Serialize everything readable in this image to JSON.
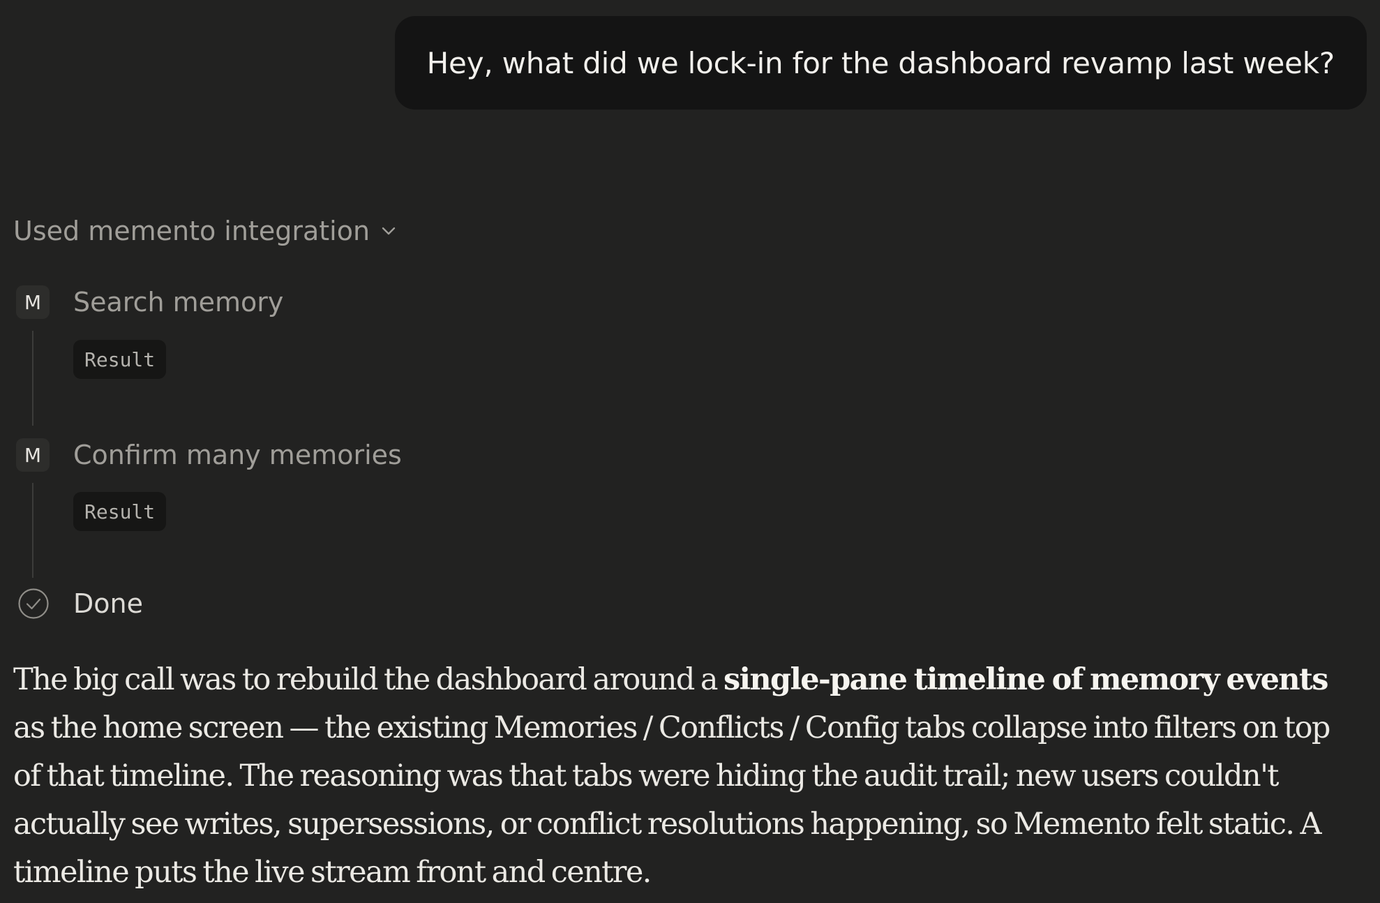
{
  "user_message": {
    "text": "Hey, what did we lock-in for the dashboard revamp last week?"
  },
  "tool_usage": {
    "header_label": "Used memento integration",
    "header_icon": "chevron-down-icon",
    "steps": [
      {
        "badge": "M",
        "label": "Search memory",
        "result_label": "Result"
      },
      {
        "badge": "M",
        "label": "Confirm many memories",
        "result_label": "Result"
      }
    ],
    "done": {
      "icon": "check-circle-icon",
      "label": "Done"
    }
  },
  "answer": {
    "lead": "The big call was to rebuild the dashboard around a ",
    "highlight": "single-pane timeline of memory events",
    "rest": " as the home screen — the existing Memories / Conflicts / Config tabs collapse into filters on top of that timeline. The reasoning was that tabs were hiding the audit trail; new users couldn't actually see writes, supersessions, or conflict resolutions happening, so Memento felt static. A timeline puts the live stream front and centre."
  },
  "colors": {
    "background": "#222221",
    "user_bubble": "#141414",
    "muted_text": "#a09e99",
    "body_text": "#ebe9e4",
    "badge_bg": "#2d2d2b",
    "result_chip_bg": "#161615",
    "timeline_line": "#3c3c3a"
  }
}
